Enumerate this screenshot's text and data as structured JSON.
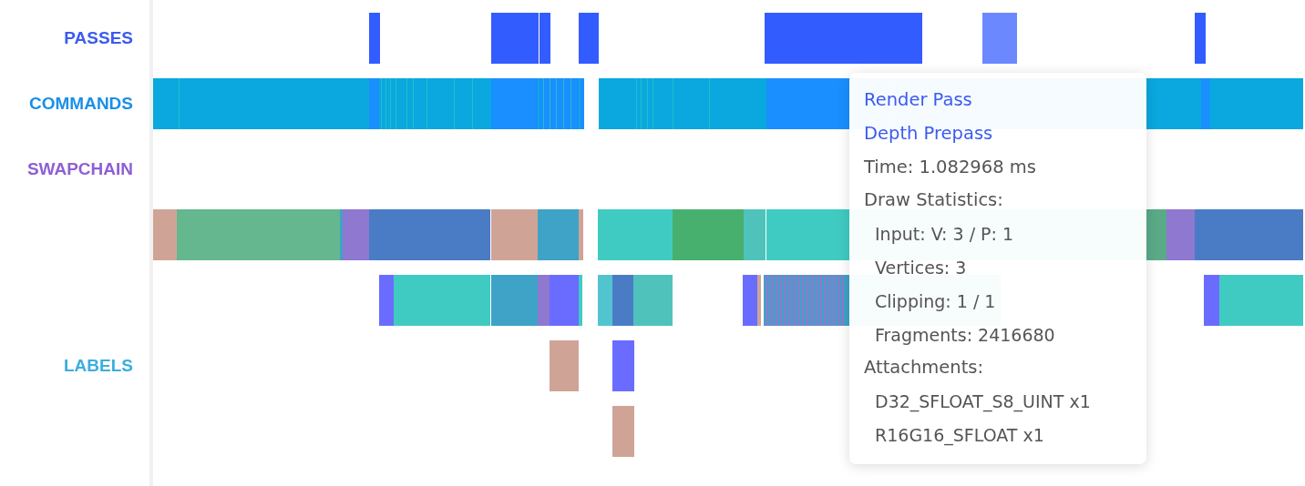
{
  "track_labels": [
    {
      "text": "PASSES",
      "color": "#3b5bf0"
    },
    {
      "text": "COMMANDS",
      "color": "#1a8fe8"
    },
    {
      "text": "SWAPCHAIN",
      "color": "#8e5fd6"
    },
    {
      "text": "LABELS",
      "color": "#3aaee0"
    }
  ],
  "tooltip": {
    "lines": [
      {
        "kind": "link",
        "text": "Render Pass"
      },
      {
        "kind": "link",
        "text": "Depth Prepass"
      },
      {
        "kind": "text",
        "text": "Time: 1.082968 ms"
      },
      {
        "kind": "text",
        "text": "Draw Statistics:",
        "children": [
          {
            "kind": "text",
            "text": "Input: V: 3 / P: 1"
          },
          {
            "kind": "text",
            "text": "Vertices: 3"
          },
          {
            "kind": "text",
            "text": "Clipping: 1 / 1"
          },
          {
            "kind": "text",
            "text": "Fragments: 2416680"
          }
        ]
      },
      {
        "kind": "text",
        "text": "Attachments:",
        "children": [
          {
            "kind": "text",
            "text": "D32_SFLOAT_S8_UINT x1"
          },
          {
            "kind": "text",
            "text": "R16G16_SFLOAT x1"
          }
        ]
      }
    ]
  }
}
